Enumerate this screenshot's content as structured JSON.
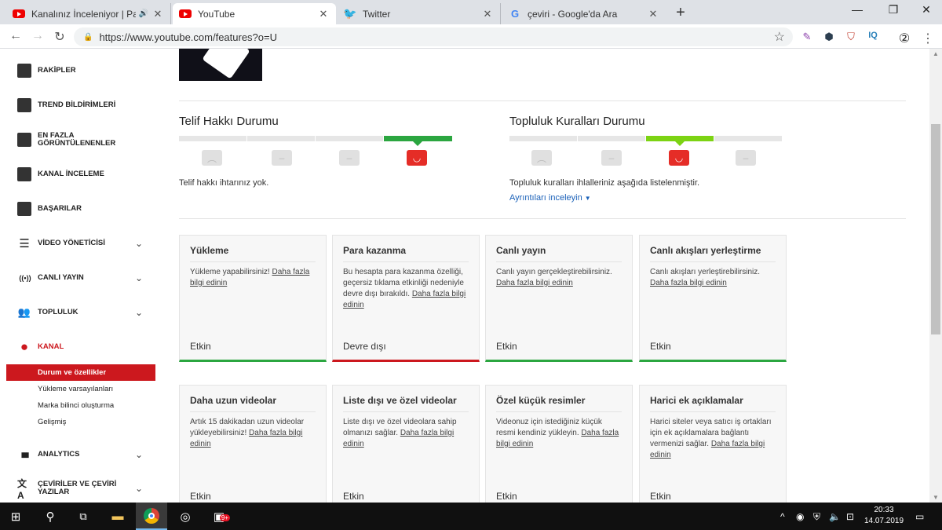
{
  "browser": {
    "tabs": [
      {
        "title": "Kanalınız İnceleniyor | Para K",
        "icon": "youtube-icon",
        "audio": "🔊"
      },
      {
        "title": "YouTube",
        "icon": "youtube-icon"
      },
      {
        "title": "Twitter",
        "icon": "twitter-icon"
      },
      {
        "title": "çeviri - Google'da Ara",
        "icon": "google-icon"
      }
    ],
    "new_tab": "+",
    "close": "✕",
    "url": "https://www.youtube.com/features?o=U",
    "win": {
      "min": "—",
      "max": "❐",
      "close": "✕"
    },
    "nav": {
      "back": "←",
      "fwd": "→",
      "reload": "↻",
      "lock": "🔒",
      "star": "☆",
      "menu": "⋮"
    },
    "ext": [
      "✎",
      "⬢",
      "⛉",
      "IQ",
      "②"
    ]
  },
  "sidebar": {
    "items": [
      {
        "label": "RAKİPLER",
        "icon": "tubebuddy-icon"
      },
      {
        "label": "TREND BİLDİRİMLERİ",
        "icon": "tubebuddy-icon"
      },
      {
        "label": "EN FAZLA GÖRÜNTÜLENENLER",
        "icon": "tubebuddy-icon"
      },
      {
        "label": "KANAL İNCELEME",
        "icon": "tubebuddy-icon"
      },
      {
        "label": "BAŞARILAR",
        "icon": "tubebuddy-icon"
      },
      {
        "label": "VİDEO YÖNETİCİSİ",
        "icon": "video-manager-icon",
        "glyph": "☰"
      },
      {
        "label": "CANLI YAYIN",
        "icon": "live-icon",
        "glyph": "((•))"
      },
      {
        "label": "TOPLULUK",
        "icon": "community-icon",
        "glyph": "👥"
      },
      {
        "label": "KANAL",
        "icon": "channel-icon",
        "glyph": "●"
      }
    ],
    "sub": [
      "Durum ve özellikler",
      "Yükleme varsayılanları",
      "Marka bilinci oluşturma",
      "Gelişmiş"
    ],
    "bottom": [
      {
        "label": "ANALYTICS",
        "icon": "analytics-icon",
        "glyph": "▮▮▮"
      },
      {
        "label": "ÇEVİRİLER VE ÇEVİRİ YAZILAR",
        "icon": "translate-icon",
        "glyph": "文A"
      }
    ],
    "chevron": "⌄",
    "accent": "#cc181e"
  },
  "status": {
    "copyright": {
      "title": "Telif Hakkı Durumu",
      "text": "Telif hakkı ihtarınız yok."
    },
    "community": {
      "title": "Topluluk Kuralları Durumu",
      "text": "Topluluk kuralları ihlalleriniz aşağıda listelenmiştir.",
      "link": "Ayrıntıları inceleyin"
    },
    "face_happy": "◡",
    "face_neutral": "–",
    "face_sad": "︵"
  },
  "features": [
    {
      "title": "Yükleme",
      "desc": "Yükleme yapabilirsiniz! ",
      "link": "Daha fazla bilgi edinin",
      "status": "Etkin"
    },
    {
      "title": "Para kazanma",
      "desc": "Bu hesapta para kazanma özelliği, geçersiz tıklama etkinliği nedeniyle devre dışı bırakıldı. ",
      "link": "Daha fazla bilgi edinin",
      "status": "Devre dışı"
    },
    {
      "title": "Canlı yayın",
      "desc": "Canlı yayın gerçekleştirebilirsiniz. ",
      "link": "Daha fazla bilgi edinin",
      "status": "Etkin"
    },
    {
      "title": "Canlı akışları yerleştirme",
      "desc": "Canlı akışları yerleştirebilirsiniz. ",
      "link": "Daha fazla bilgi edinin",
      "status": "Etkin"
    },
    {
      "title": "Daha uzun videolar",
      "desc": "Artık 15 dakikadan uzun videolar yükleyebilirsiniz! ",
      "link": "Daha fazla bilgi edinin",
      "status": "Etkin"
    },
    {
      "title": "Liste dışı ve özel videolar",
      "desc": "Liste dışı ve özel videolara sahip olmanızı sağlar. ",
      "link": "Daha fazla bilgi edinin",
      "status": "Etkin"
    },
    {
      "title": "Özel küçük resimler",
      "desc": "Videonuz için istediğiniz küçük resmi kendiniz yükleyin. ",
      "link": "Daha fazla bilgi edinin",
      "status": "Etkin"
    },
    {
      "title": "Harici ek açıklamalar",
      "desc": "Harici siteler veya satıcı iş ortakları için ek açıklamalara bağlantı vermenizi sağlar. ",
      "link": "Daha fazla bilgi edinin",
      "status": "Etkin"
    }
  ],
  "taskbar": {
    "time": "20:33",
    "date": "14.07.2019",
    "badge": "9+"
  }
}
